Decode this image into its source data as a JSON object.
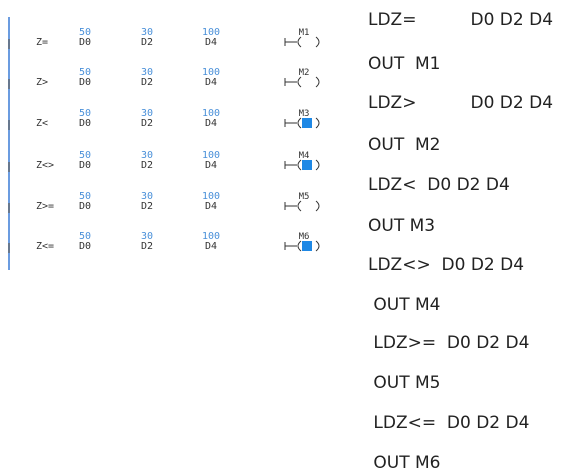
{
  "rungs": [
    {
      "op": "Z=",
      "coil": "M1",
      "coil_active": false
    },
    {
      "op": "Z>",
      "coil": "M2",
      "coil_active": false
    },
    {
      "op": "Z<",
      "coil": "M3",
      "coil_active": true
    },
    {
      "op": "Z<>",
      "coil": "M4",
      "coil_active": true
    },
    {
      "op": "Z>=",
      "coil": "M5",
      "coil_active": false
    },
    {
      "op": "Z<=",
      "coil": "M6",
      "coil_active": true
    }
  ],
  "operands": [
    {
      "value": "50",
      "register": "D0"
    },
    {
      "value": "30",
      "register": "D2"
    },
    {
      "value": "100",
      "register": "D4"
    }
  ],
  "instructions": [
    {
      "text": "LDZ=          D0 D2 D4"
    },
    {
      "text": "OUT  M1"
    },
    {
      "text": "LDZ>          D0 D2 D4"
    },
    {
      "text": "OUT  M2"
    },
    {
      "text": "LDZ<  D0 D2 D4"
    },
    {
      "text": "OUT M3"
    },
    {
      "text": "LDZ<>  D0 D2 D4"
    },
    {
      "text": " OUT M4"
    },
    {
      "text": " LDZ>=  D0 D2 D4"
    },
    {
      "text": " OUT M5"
    },
    {
      "text": " LDZ<=  D0 D2 D4"
    },
    {
      "text": " OUT M6"
    }
  ],
  "colors": {
    "rail": "#3a7bd5",
    "value": "#4a90d9",
    "register": "#333333",
    "coil_active": "#1e88e5",
    "line": "#333333",
    "text": "#222222"
  }
}
